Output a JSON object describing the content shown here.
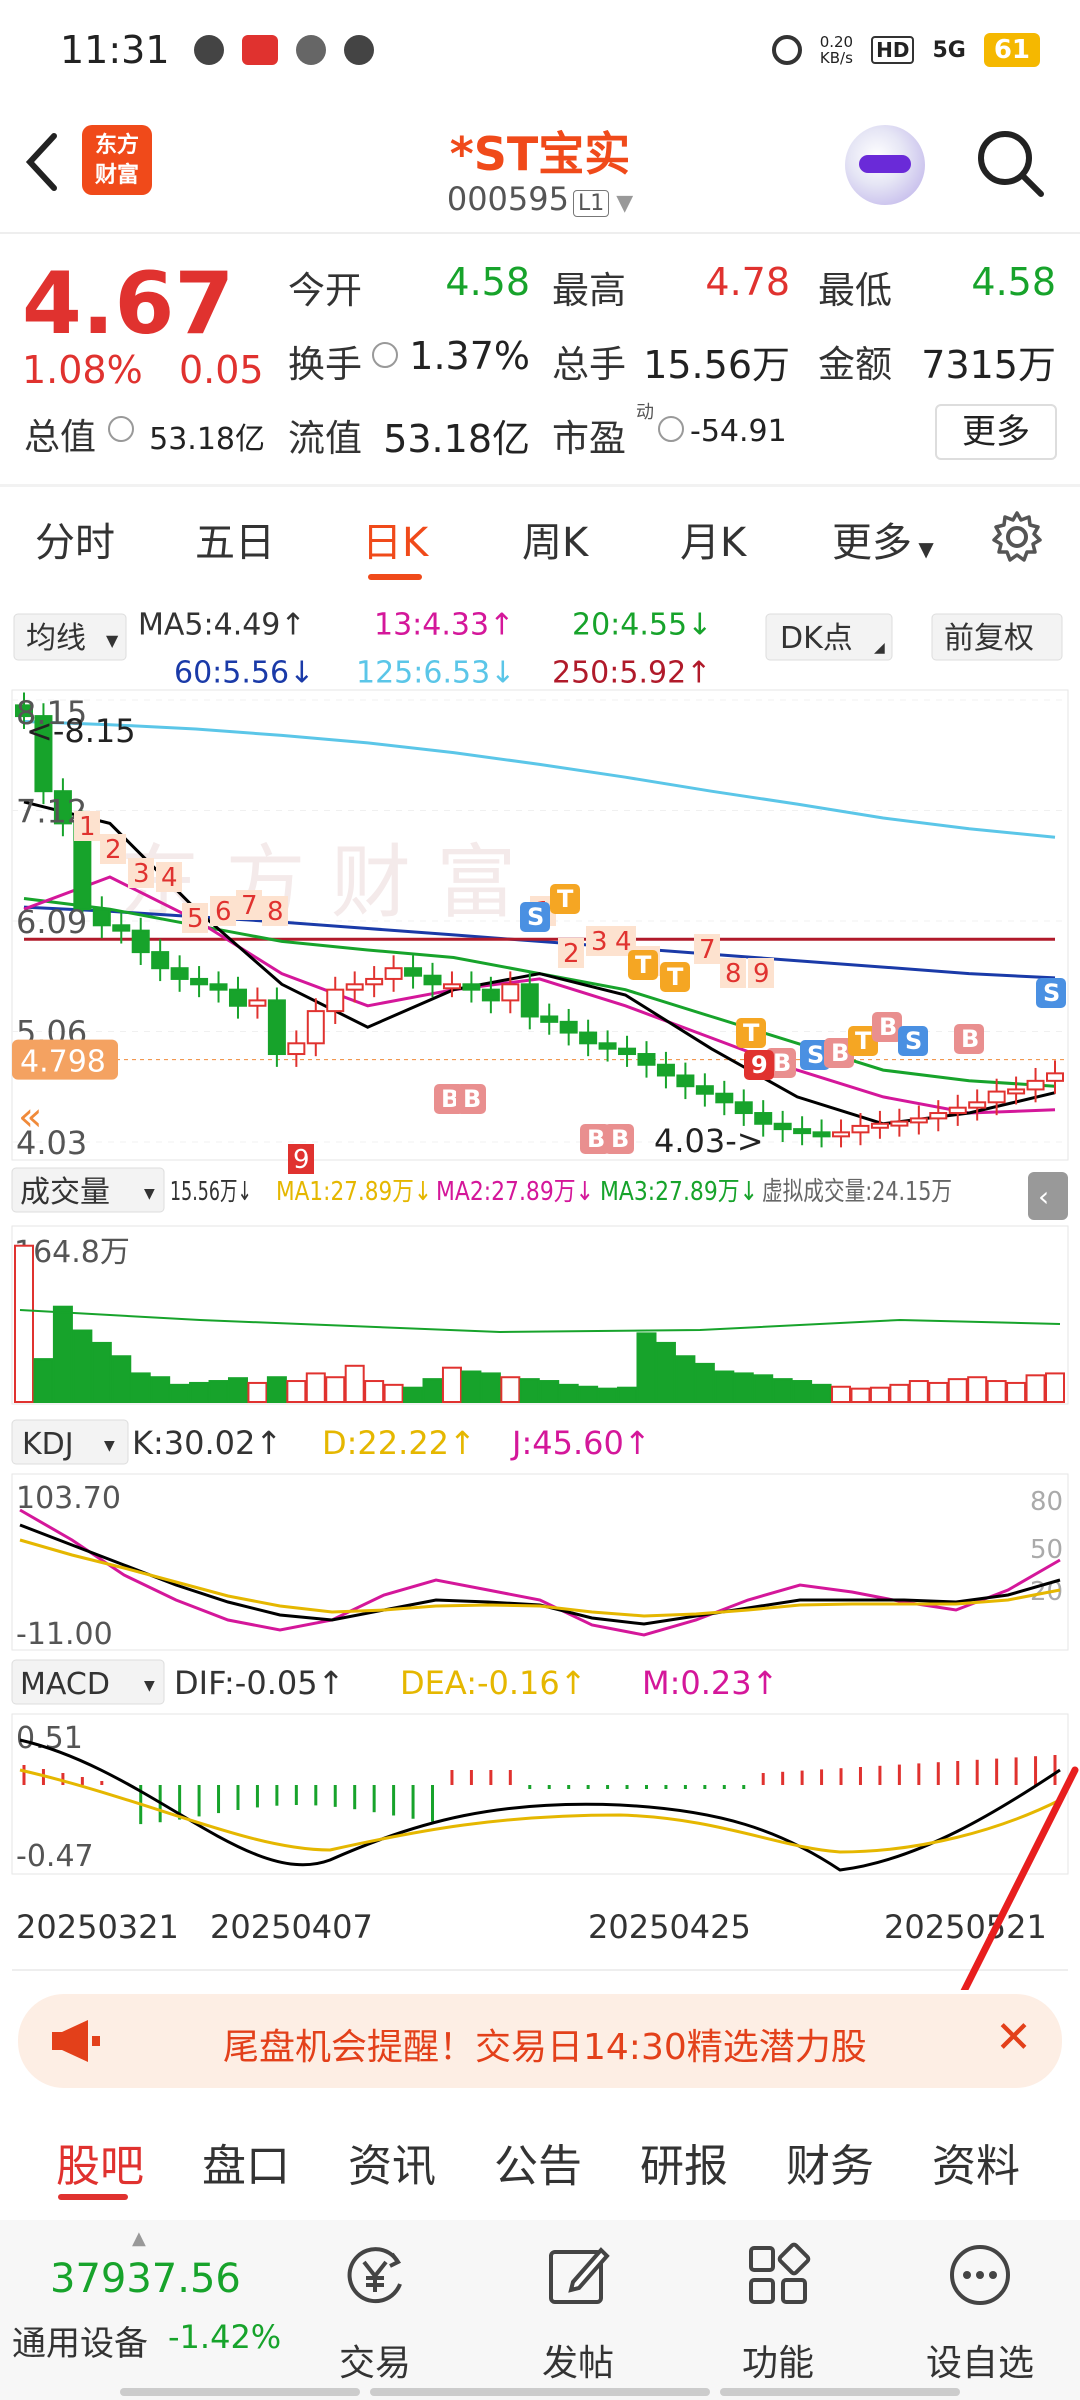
{
  "status_bar": {
    "time": "11:31",
    "net_speed": "0.20\nKB/s",
    "net_speed_top": "0.20",
    "net_speed_bottom": "KB/s",
    "hd": "HD",
    "signal": "5G",
    "battery": "61"
  },
  "header": {
    "logo": "东方财富",
    "stock_name": "*ST宝实",
    "stock_code": "000595",
    "level": "L1"
  },
  "quote": {
    "price": "4.67",
    "change_pct": "1.08%",
    "change_amt": "0.05",
    "open_label": "今开",
    "open": "4.58",
    "high_label": "最高",
    "high": "4.78",
    "low_label": "最低",
    "low": "4.58",
    "turnover_label": "换手",
    "turnover": "1.37%",
    "volume_label": "总手",
    "volume": "15.56万",
    "amount_label": "金额",
    "amount": "7315万",
    "mktcap_label": "总值",
    "mktcap": "53.18亿",
    "float_label": "流值",
    "float_cap": "53.18亿",
    "pe_label": "市盈",
    "pe_sup": "动",
    "pe": "-54.91",
    "more_btn": "更多"
  },
  "chart_tabs": [
    "分时",
    "五日",
    "日K",
    "周K",
    "月K",
    "更多"
  ],
  "chart_tab_active": "日K",
  "ma_bar": {
    "selector": "均线",
    "ma5": "MA5:4.49↑",
    "ma13": "13:4.33↑",
    "ma20": "20:4.55↓",
    "ma60": "60:5.56↓",
    "ma125": "125:6.53↓",
    "ma250": "250:5.92↑",
    "dk_btn": "DK点",
    "fq_btn": "前复权"
  },
  "kline": {
    "y_labels": [
      "8.15",
      "7.12",
      "6.09",
      "5.06",
      "4.03"
    ],
    "max_label": "<-8.15",
    "min_label": "4.03->",
    "current_tag": "4.798",
    "colors": {
      "up": "#e0322f",
      "down": "#17a32b",
      "ma5": "#000000",
      "ma13": "#d4179a",
      "ma20": "#17a32b",
      "ma60": "#1a3aa8",
      "ma125": "#5bc6e8",
      "ma250": "#b01a2a"
    },
    "td_down_labels": [
      "1",
      "2",
      "3",
      "4",
      "5",
      "6",
      "7",
      "8",
      "9"
    ],
    "td_up_labels": [
      "1",
      "2",
      "3",
      "4",
      "5",
      "7",
      "8",
      "9"
    ],
    "markers": {
      "S": "S",
      "T": "T",
      "B": "B",
      "nine_flag": "9"
    }
  },
  "volume_panel": {
    "selector": "成交量",
    "vol": "15.56万↓",
    "ma1": "MA1:27.89万↓",
    "ma2": "MA2:27.89万↓",
    "ma3": "MA3:27.89万↓",
    "est": "虚拟成交量:24.15万",
    "max_label": "164.8万"
  },
  "kdj_panel": {
    "selector": "KDJ",
    "k": "K:30.02↑",
    "d": "D:22.22↑",
    "j": "J:45.60↑",
    "max_label": "103.70",
    "min_label": "-11.00",
    "ref": [
      "80",
      "50",
      "20"
    ]
  },
  "macd_panel": {
    "selector": "MACD",
    "dif": "DIF:-0.05↑",
    "dea": "DEA:-0.16↑",
    "m": "M:0.23↑",
    "max_label": "0.51",
    "min_label": "-0.47"
  },
  "dates": [
    "20250321",
    "20250407",
    "20250425",
    "20250521"
  ],
  "banner": {
    "text": "尾盘机会提醒！交易日14:30精选潜力股"
  },
  "bottom_tabs": [
    "股吧",
    "盘口",
    "资讯",
    "公告",
    "研报",
    "财务",
    "资料"
  ],
  "bottom_tab_active": "股吧",
  "bottom_nav": {
    "index_value": "37937.56",
    "index_name": "通用设备",
    "index_pct": "-1.42%",
    "items": [
      "交易",
      "发帖",
      "功能",
      "设自选"
    ]
  }
}
